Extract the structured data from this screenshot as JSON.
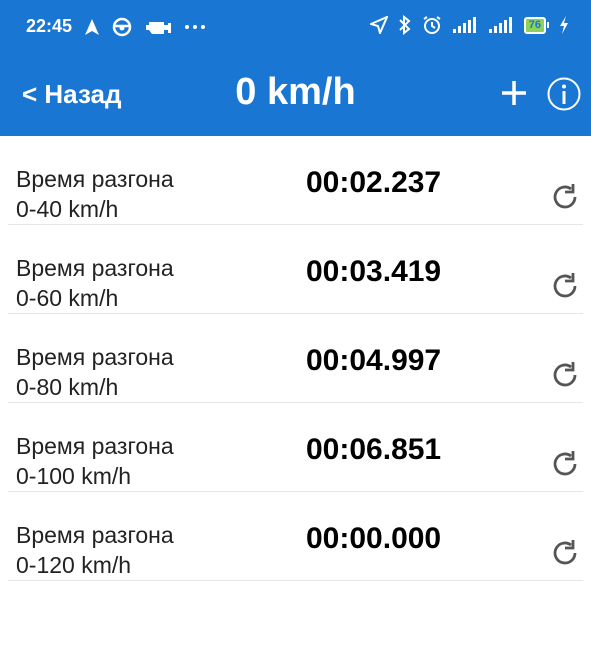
{
  "statusbar": {
    "time": "22:45",
    "battery": "76"
  },
  "header": {
    "back_label": "< Назад",
    "title": "0 km/h"
  },
  "rows": [
    {
      "label_line1": "Время разгона",
      "label_line2": "0-40 km/h",
      "time": "00:02.237"
    },
    {
      "label_line1": "Время разгона",
      "label_line2": "0-60 km/h",
      "time": "00:03.419"
    },
    {
      "label_line1": "Время разгона",
      "label_line2": "0-80 km/h",
      "time": "00:04.997"
    },
    {
      "label_line1": "Время разгона",
      "label_line2": "0-100 km/h",
      "time": "00:06.851"
    },
    {
      "label_line1": "Время разгона",
      "label_line2": "0-120 km/h",
      "time": "00:00.000"
    }
  ],
  "icons": {
    "back": "chevron-left-icon",
    "add": "plus-icon",
    "info": "info-circle-icon",
    "reset": "refresh-icon"
  },
  "colors": {
    "accent": "#1976d2",
    "battery": "#8ed15a"
  }
}
